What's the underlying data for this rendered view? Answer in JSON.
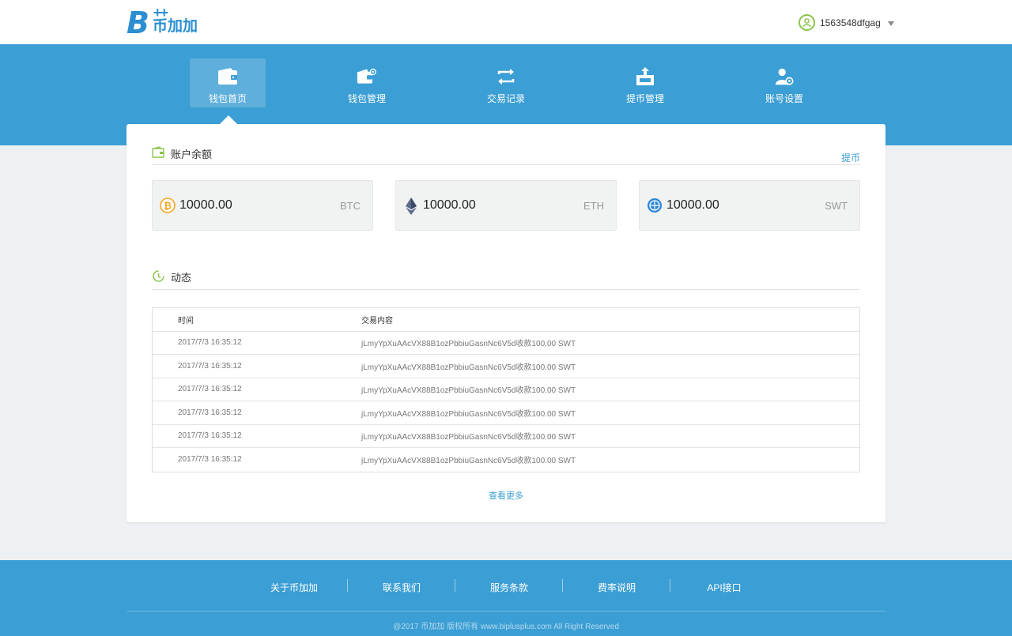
{
  "header": {
    "logo_text": "币加加",
    "username": "1563548dfgag"
  },
  "nav": [
    {
      "label": "钱包首页",
      "icon": "wallet-icon",
      "active": true
    },
    {
      "label": "钱包管理",
      "icon": "wallet-settings-icon",
      "active": false
    },
    {
      "label": "交易记录",
      "icon": "transfer-icon",
      "active": false
    },
    {
      "label": "提币管理",
      "icon": "withdraw-icon",
      "active": false
    },
    {
      "label": "账号设置",
      "icon": "account-settings-icon",
      "active": false
    }
  ],
  "balance_section": {
    "title": "账户余额",
    "withdraw_link": "提币",
    "items": [
      {
        "amount": "10000.00",
        "symbol": "BTC",
        "icon": "bitcoin-icon",
        "color": "#f5a623"
      },
      {
        "amount": "10000.00",
        "symbol": "ETH",
        "icon": "ethereum-icon",
        "color": "#5a6a8a"
      },
      {
        "amount": "10000.00",
        "symbol": "SWT",
        "icon": "swt-icon",
        "color": "#2b86d6"
      }
    ]
  },
  "activity_section": {
    "title": "动态",
    "columns": [
      "时间",
      "交易内容"
    ],
    "rows": [
      {
        "time": "2017/7/3 16:35:12",
        "content": "jLmyYpXuAAcVX88B1ozPbbiuGasnNc6V5d收款100.00 SWT"
      },
      {
        "time": "2017/7/3 16:35:12",
        "content": "jLmyYpXuAAcVX88B1ozPbbiuGasnNc6V5d收款100.00 SWT"
      },
      {
        "time": "2017/7/3 16:35:12",
        "content": "jLmyYpXuAAcVX88B1ozPbbiuGasnNc6V5d收款100.00 SWT"
      },
      {
        "time": "2017/7/3 16:35:12",
        "content": "jLmyYpXuAAcVX88B1ozPbbiuGasnNc6V5d收款100.00 SWT"
      },
      {
        "time": "2017/7/3 16:35:12",
        "content": "jLmyYpXuAAcVX88B1ozPbbiuGasnNc6V5d收款100.00 SWT"
      },
      {
        "time": "2017/7/3 16:35:12",
        "content": "jLmyYpXuAAcVX88B1ozPbbiuGasnNc6V5d收款100.00 SWT"
      }
    ],
    "more_link": "查看更多"
  },
  "footer": {
    "links": [
      "关于币加加",
      "联系我们",
      "服务条款",
      "费率说明",
      "API接口"
    ],
    "copyright": "@2017 币加加 版权所有 www.biplusplus.com All Right Reserved"
  },
  "colors": {
    "primary": "#3b9ed4",
    "accent_green": "#8bc34a",
    "page_bg": "#eef1f3"
  }
}
